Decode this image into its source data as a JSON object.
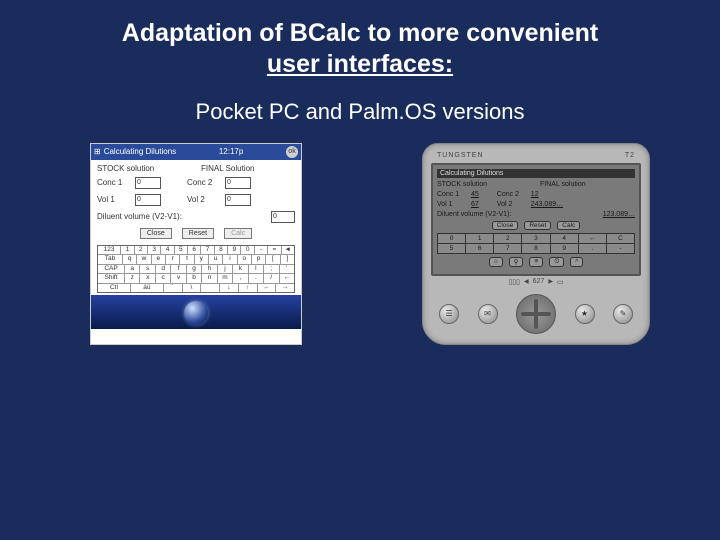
{
  "title_line1": "Adaptation of BCalc to more convenient",
  "title_line2": "user interfaces:",
  "subtitle": "Pocket PC and Palm.OS versions",
  "ppc": {
    "bar_title": "Calculating Dilutions",
    "bar_time": "12:17p",
    "bar_ok": "ok",
    "hdr_stock": "STOCK solution",
    "hdr_final": "FINAL Solution",
    "conc1_label": "Conc 1",
    "conc1_value": "0",
    "conc2_label": "Conc 2",
    "conc2_value": "0",
    "vol1_label": "Vol 1",
    "vol1_value": "0",
    "vol2_label": "Vol 2",
    "vol2_value": "0",
    "diluent_label": "Diluent volume (V2-V1):",
    "diluent_value": "0",
    "btn_close": "Close",
    "btn_reset": "Reset",
    "btn_calc": "Calc",
    "krow1": [
      "123",
      "1",
      "2",
      "3",
      "4",
      "5",
      "6",
      "7",
      "8",
      "9",
      "0",
      "-",
      "=",
      "◄"
    ],
    "krow2": [
      "Tab",
      "q",
      "w",
      "e",
      "r",
      "t",
      "y",
      "u",
      "i",
      "o",
      "p",
      "[",
      "]"
    ],
    "krow3": [
      "CAP",
      "a",
      "s",
      "d",
      "f",
      "g",
      "h",
      "j",
      "k",
      "l",
      ";",
      "'"
    ],
    "krow4": [
      "Shift",
      "z",
      "x",
      "c",
      "v",
      "b",
      "n",
      "m",
      ",",
      ".",
      "/",
      "←"
    ],
    "krow5": [
      "Ctl",
      "áü",
      "`",
      "\\",
      " ",
      "↓",
      "↑",
      "←",
      "→"
    ]
  },
  "palm": {
    "brand": "TUNGSTEN",
    "brand2": "T2",
    "bar_title": "Calculating Dilutions",
    "hdr_stock": "STOCK solution",
    "hdr_final": "FINAL solution",
    "conc1_label": "Conc 1",
    "conc1_value": "45",
    "conc2_label": "Conc 2",
    "conc2_value": "12",
    "vol1_label": "Vol 1",
    "vol1_value": "67",
    "vol2_label": "Vol 2",
    "vol2_value": "243.089…",
    "diluent_label": "Diluent volume (V2-V1):",
    "diluent_value": "123.089…",
    "btn_close": "Close",
    "btn_reset": "Reset",
    "btn_calc": "Calc",
    "nrow1": [
      "0",
      "1",
      "2",
      "3",
      "4",
      "←",
      "C"
    ],
    "nrow2": [
      "5",
      "6",
      "7",
      "8",
      "9",
      ".",
      "-"
    ],
    "counter": "627"
  }
}
